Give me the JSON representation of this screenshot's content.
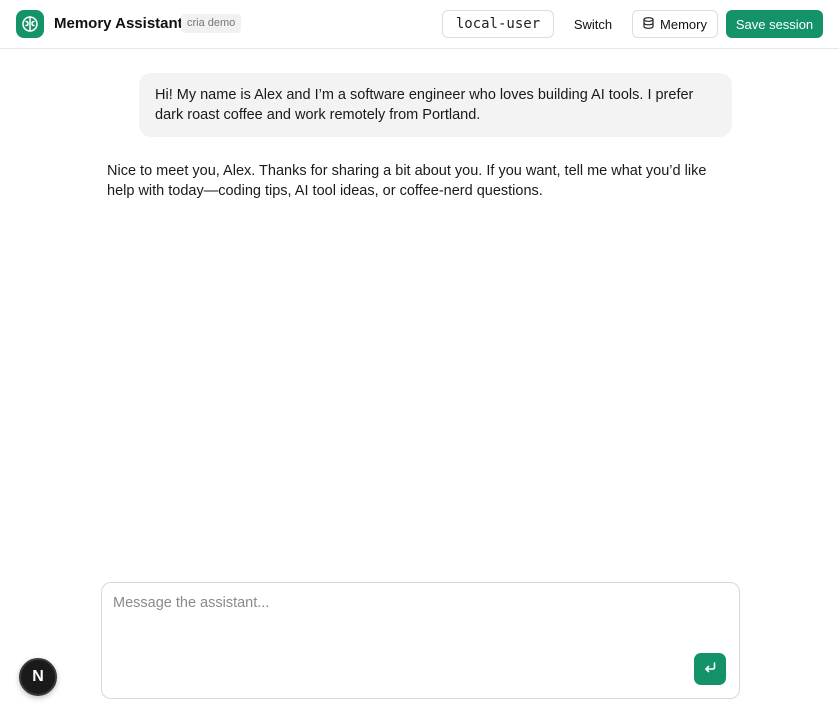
{
  "header": {
    "logo_icon": "brain-icon",
    "title": "Memory Assistant",
    "tag": "cria demo",
    "user_id": "local-user",
    "switch_label": "Switch",
    "memory_label": "Memory",
    "memory_icon": "database-icon",
    "save_label": "Save session"
  },
  "messages": [
    {
      "role": "user",
      "text": "Hi! My name is Alex and I’m a software engineer who loves building AI tools. I prefer dark roast coffee and work remotely from Portland."
    },
    {
      "role": "assistant",
      "text": "Nice to meet you, Alex. Thanks for sharing a bit about you. If you want, tell me what you’d like help with today—coding tips, AI tool ideas, or coffee-nerd questions."
    }
  ],
  "composer": {
    "placeholder": "Message the assistant...",
    "value": "",
    "send_icon": "enter-icon"
  },
  "dev_badge": {
    "label": "N"
  },
  "colors": {
    "accent": "#14936a",
    "bubble": "#f3f3f3",
    "border": "#dcdcdc"
  }
}
